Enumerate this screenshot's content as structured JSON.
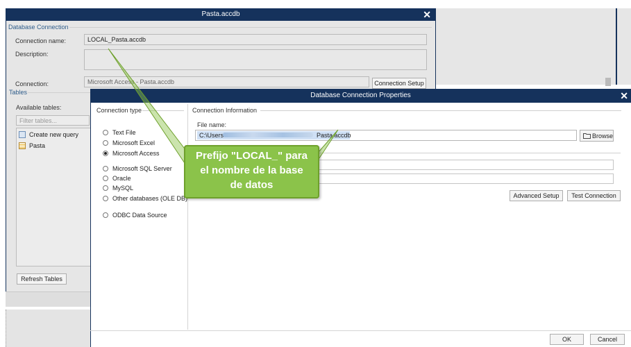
{
  "bg_window": {
    "title": "Pasta.accdb",
    "db_section": "Database Connection",
    "conn_name_label": "Connection name:",
    "conn_name_value": "LOCAL_Pasta.accdb",
    "description_label": "Description:",
    "connection_label": "Connection:",
    "connection_value": "Microsoft Access - Pasta.accdb",
    "connection_setup": "Connection Setup",
    "tables_section": "Tables",
    "available_tables": "Available tables:",
    "filter_placeholder": "Filter tables...",
    "tables": [
      {
        "label": "Create new query",
        "icon": "query-icon"
      },
      {
        "label": "Pasta",
        "icon": "table-icon"
      }
    ],
    "refresh_tables": "Refresh Tables"
  },
  "dialog": {
    "title": "Database Connection Properties",
    "connection_type_label": "Connection type",
    "types": [
      {
        "label": "Text File",
        "selected": false
      },
      {
        "label": "Microsoft Excel",
        "selected": false
      },
      {
        "label": "Microsoft Access",
        "selected": true
      },
      {
        "label": "Microsoft SQL Server",
        "selected": false
      },
      {
        "label": "Oracle",
        "selected": false
      },
      {
        "label": "MySQL",
        "selected": false
      },
      {
        "label": "Other databases (OLE DB)",
        "selected": false
      },
      {
        "label": "ODBC Data Source",
        "selected": false
      }
    ],
    "connection_info_label": "Connection Information",
    "file_name_label": "File name:",
    "file_name_start": "C:\\Users\\",
    "file_name_end": "Pasta.accdb",
    "browse": "Browse",
    "advanced_setup": "Advanced Setup",
    "test_connection": "Test Connection",
    "ok": "OK",
    "cancel": "Cancel"
  },
  "callout": {
    "line1": "Prefijo \"LOCAL_\" para",
    "line2": "el nombre de la base",
    "line3": "de datos"
  },
  "colors": {
    "titlebar": "#15325c",
    "callout_fill": "#8bc34a",
    "callout_border": "#6ea02c",
    "selection": "#cfe0f5"
  }
}
